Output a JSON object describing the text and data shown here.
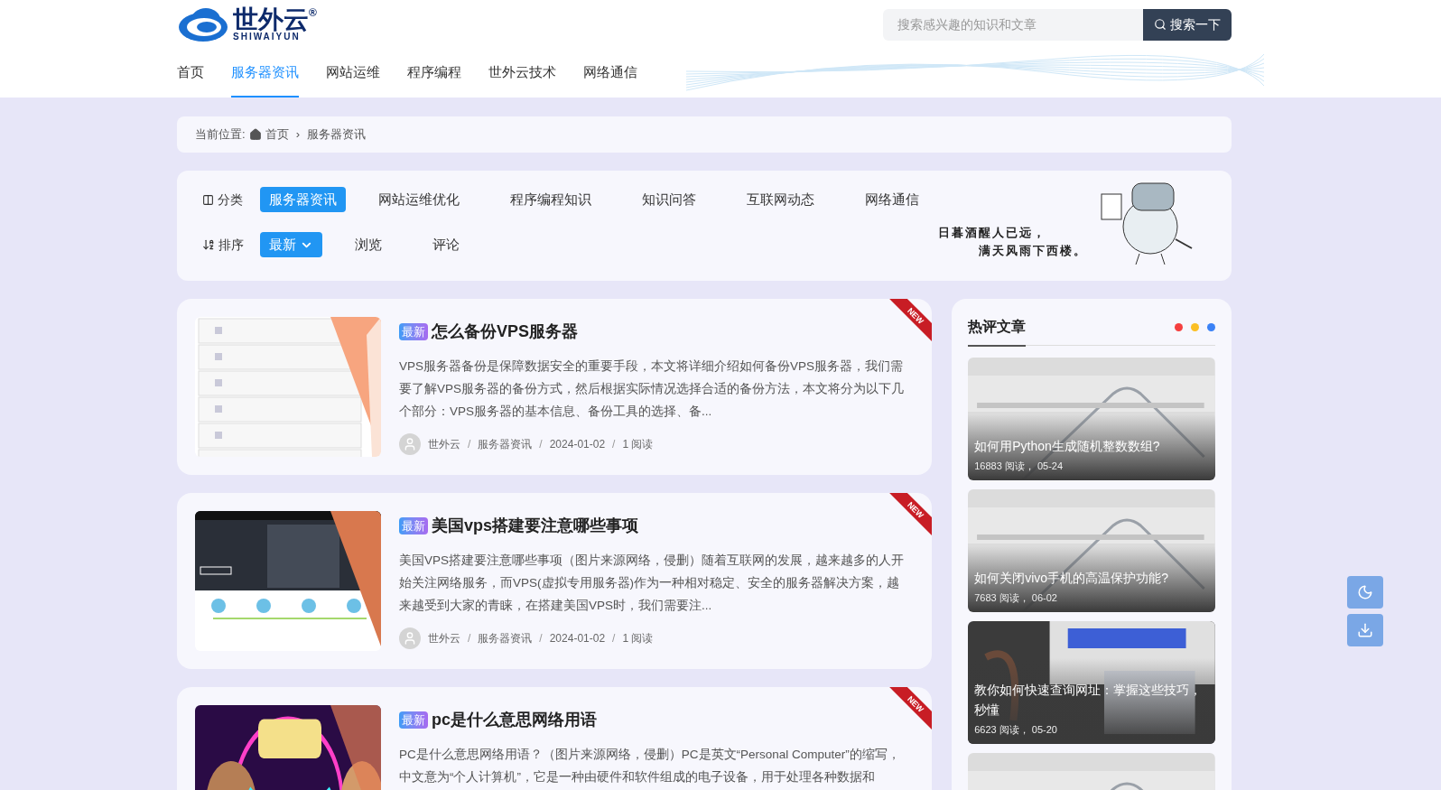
{
  "logo": {
    "name": "世外云",
    "mark": "®",
    "subtitle": "SHIWAIYUN"
  },
  "search": {
    "placeholder": "搜索感兴趣的知识和文章",
    "button": "搜索一下"
  },
  "nav": [
    {
      "label": "首页",
      "selected": false
    },
    {
      "label": "服务器资讯",
      "selected": true
    },
    {
      "label": "网站运维",
      "selected": false
    },
    {
      "label": "程序编程",
      "selected": false
    },
    {
      "label": "世外云技术",
      "selected": false
    },
    {
      "label": "网络通信",
      "selected": false
    }
  ],
  "breadcrumb": {
    "prefix": "当前位置:",
    "home": "首页",
    "sep": "›",
    "current": "服务器资讯"
  },
  "filters": [
    {
      "label": "分类",
      "kind": "category",
      "options": [
        {
          "label": "服务器资讯",
          "selected": true
        },
        {
          "label": "网站运维优化",
          "selected": false
        },
        {
          "label": "程序编程知识",
          "selected": false
        },
        {
          "label": "知识问答",
          "selected": false
        },
        {
          "label": "互联网动态",
          "selected": false
        },
        {
          "label": "网络通信",
          "selected": false
        }
      ]
    },
    {
      "label": "排序",
      "kind": "sort",
      "options": [
        {
          "label": "最新",
          "selected": true
        },
        {
          "label": "浏览",
          "selected": false
        },
        {
          "label": "评论",
          "selected": false
        }
      ]
    }
  ],
  "banner_poem": [
    "日暮酒醒人已远，",
    "满天风雨下西楼。"
  ],
  "articles": [
    {
      "badge": "最新",
      "ribbon": "NEW",
      "title": "怎么备份VPS服务器",
      "excerpt": "VPS服务器备份是保障数据安全的重要手段，本文将详细介绍如何备份VPS服务器，我们需要了解VPS服务器的备份方式，然后根据实际情况选择合适的备份方法，本文将分为以下几个部分：VPS服务器的基本信息、备份工具的选择、备...",
      "author": "世外云",
      "category": "服务器资讯",
      "date": "2024-01-02",
      "views": "1 阅读",
      "sep": "/",
      "kind": "list"
    },
    {
      "badge": "最新",
      "ribbon": "NEW",
      "title": "美国vps搭建要注意哪些事项",
      "excerpt": "美国VPS搭建要注意哪些事项（图片来源网络，侵删）随着互联网的发展，越来越多的人开始关注网络服务，而VPS(虚拟专用服务器)作为一种相对稳定、安全的服务器解决方案，越来越受到大家的青睐，在搭建美国VPS时，我们需要注...",
      "author": "世外云",
      "category": "服务器资讯",
      "date": "2024-01-02",
      "views": "1 阅读",
      "sep": "/",
      "kind": "site"
    },
    {
      "badge": "最新",
      "ribbon": "NEW",
      "title": "pc是什么意思网络用语",
      "excerpt": "PC是什么意思网络用语？（图片来源网络，侵删）PC是英文“Personal Computer”的缩写，中文意为“个人计算机”，它是一种由硬件和软件组成的电子设备，用于处理各种数据和",
      "kind": "neon"
    }
  ],
  "sidebar": {
    "title": "热评文章",
    "dots": [
      {
        "color": "#f53f3f"
      },
      {
        "color": "#fbbf24"
      },
      {
        "color": "#3b82f6"
      }
    ],
    "items": [
      {
        "title": "如何用Python生成随机整数数组?",
        "meta": "16883 阅读， 05-24",
        "kind": "light"
      },
      {
        "title": "如何关闭vivo手机的高温保护功能?",
        "meta": "7683 阅读， 06-02",
        "kind": "light"
      },
      {
        "title": "教你如何快速查询网址：掌握这些技巧，秒懂",
        "meta": "6623 阅读， 05-20",
        "kind": "dark"
      },
      {
        "kind": "light"
      }
    ]
  }
}
